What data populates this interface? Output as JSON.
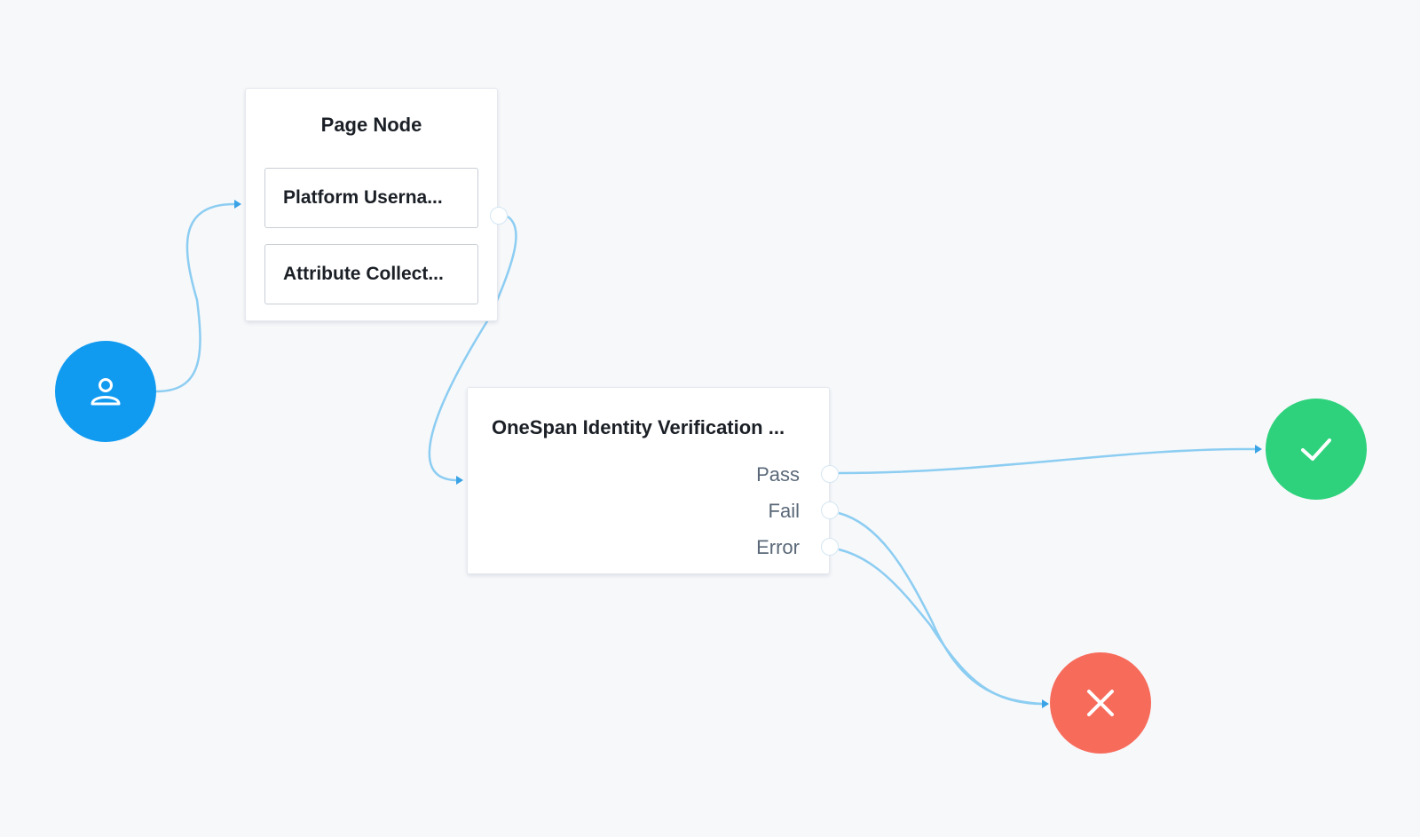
{
  "canvas": {
    "background": "#f7f8fa",
    "edge_color": "#8ccdf2"
  },
  "start_node": {
    "icon": "user-icon",
    "color": "#119bf0"
  },
  "page_node": {
    "title": "Page Node",
    "children": [
      {
        "label": "Platform Userna..."
      },
      {
        "label": "Attribute Collect..."
      }
    ]
  },
  "onespan_node": {
    "title": "OneSpan Identity Verification ...",
    "outcomes": [
      {
        "label": "Pass"
      },
      {
        "label": "Fail"
      },
      {
        "label": "Error"
      }
    ]
  },
  "success_node": {
    "icon": "check-icon",
    "color": "#2ed27c"
  },
  "failure_node": {
    "icon": "close-icon",
    "color": "#f76b5b"
  }
}
